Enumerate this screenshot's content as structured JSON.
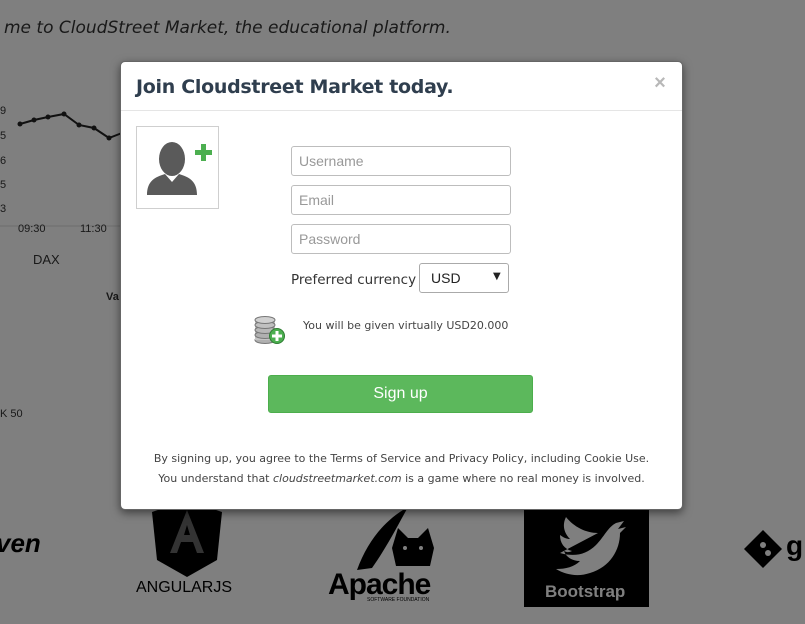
{
  "background": {
    "welcome_text": "me to CloudStreet Market, the educational platform.",
    "chart": {
      "y_tick_labels": [
        "9",
        "5",
        "6",
        "5",
        "3"
      ],
      "x_tick_labels": [
        "09:30",
        "11:30"
      ],
      "index_label": "DAX"
    },
    "misc_labels": [
      "Va",
      "K 50"
    ],
    "logos": {
      "maven": "ven",
      "angular": "ANGULARJS",
      "apache": "Apache",
      "apache_sub": "SOFTWARE FOUNDATION",
      "bootstrap": "Bootstrap",
      "git": "g"
    }
  },
  "modal": {
    "title": "Join Cloudstreet Market today.",
    "close_label": "×",
    "form": {
      "username_placeholder": "Username",
      "email_placeholder": "Email",
      "password_placeholder": "Password",
      "currency_label": "Preferred currency",
      "currency_value": "USD"
    },
    "bonus_text": "You will be given virtually USD20.000",
    "signup_label": "Sign up",
    "terms_line1": "By signing up, you agree to the Terms of Service and Privacy Policy, including Cookie Use.",
    "terms_line2_pre": "You understand that ",
    "terms_line2_site": "cloudstreetmarket.com",
    "terms_line2_post": " is a game where no real money is involved."
  },
  "colors": {
    "signup_button": "#5cb85c",
    "title": "#2f3e4e",
    "overlay": "rgba(0,0,0,0.5)"
  }
}
